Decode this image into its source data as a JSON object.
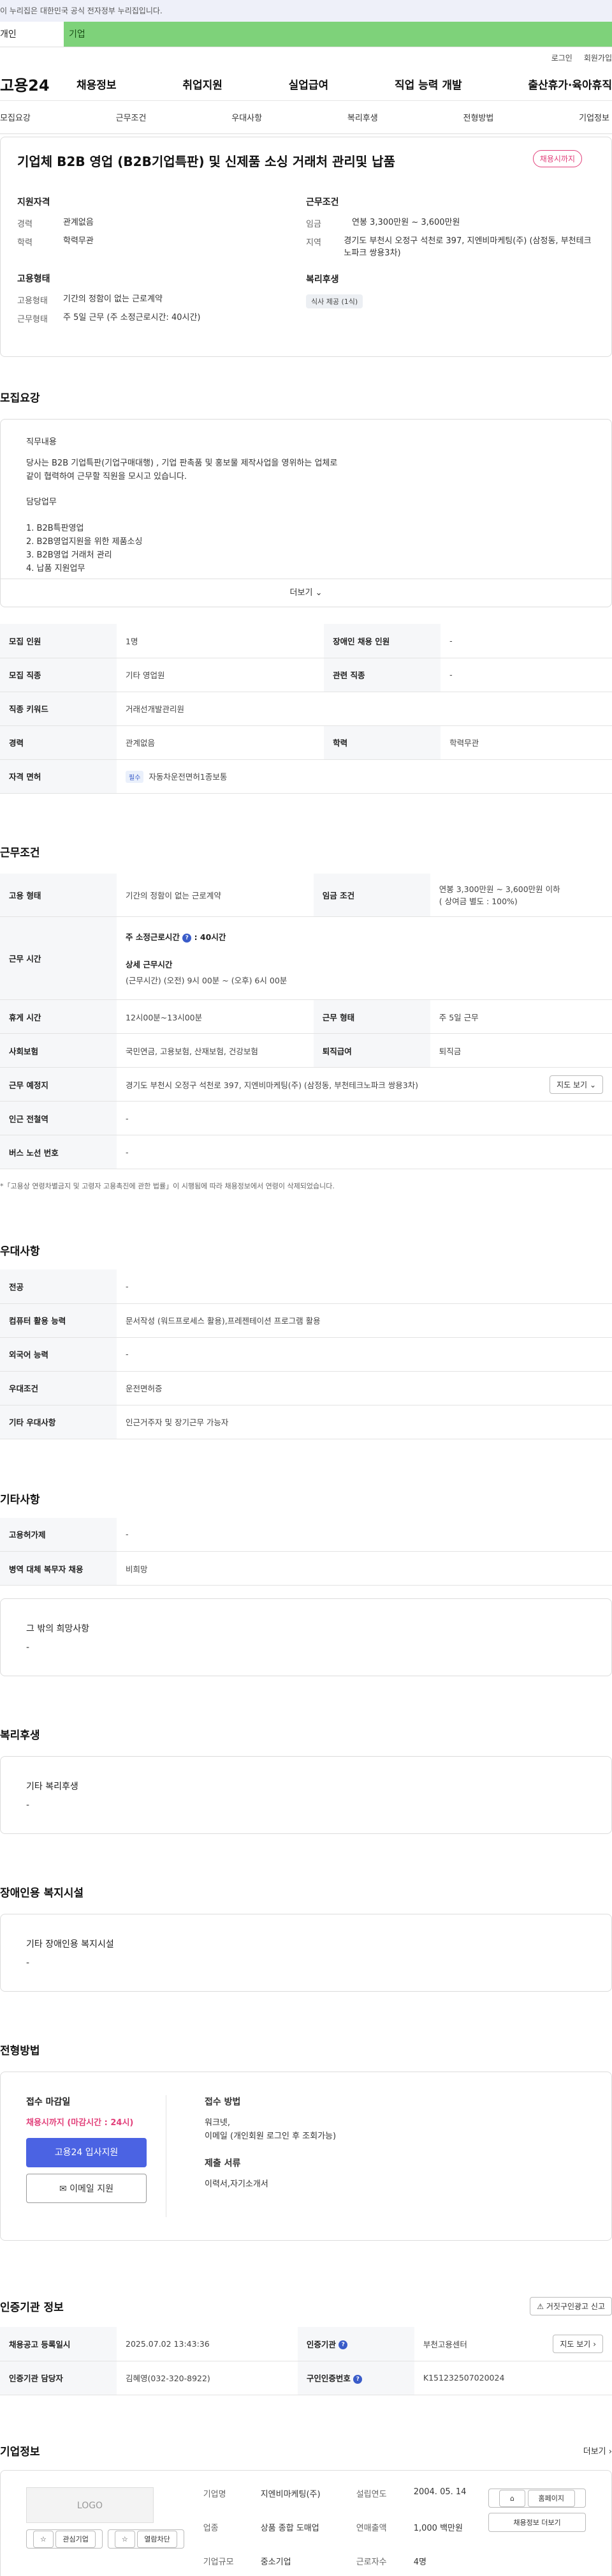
{
  "gov_banner": {
    "text": "이 누리집은 대한민국 공식 전자정부 누리집입니다."
  },
  "role_tabs": {
    "personal": "개인",
    "company": "기업"
  },
  "util": {
    "login": "로그인",
    "signup": "회원가입"
  },
  "gnb": {
    "logo": "고용24",
    "menu": [
      "채용정보",
      "취업지원",
      "실업급여",
      "직업 능력 개발",
      "출산휴가·육아휴직"
    ]
  },
  "anchor_tabs": [
    "모집요강",
    "근무조건",
    "우대사항",
    "복리후생",
    "전형방법",
    "기업정보"
  ],
  "job": {
    "title": "기업체 B2B 영업 (B2B기업특판) 및 신제품 소싱 거래처 관리및 납품",
    "badge": "채용시까지",
    "qual_head": "지원자격",
    "cond_head": "근무조건",
    "emp_head": "고용형태",
    "welfare_head": "복리후생",
    "career_k": "경력",
    "career_v": "관계없음",
    "edu_k": "학력",
    "edu_v": "학력무관",
    "wage_k": "임금",
    "wage_v": "연봉 3,300만원 ~ 3,600만원",
    "region_k": "지역",
    "region_v": "경기도 부천시 오정구 석천로 397, 지엔비마케팅(주) (삼정동, 부천테크노파크 쌍용3차)",
    "emptype_k": "고용형태",
    "emptype_v": "기간의 정함이 없는 근로계약",
    "worktype_k": "근무형태",
    "worktype_v": "주 5일 근무 (주 소정근로시간: 40시간)",
    "welfare_v": "식사 제공 (1식)"
  },
  "recruit": {
    "title": "모집요강",
    "desc_head": "직무내용",
    "desc_line1": "당사는 B2B 기업특판(기업구매대행) , 기업 판촉품 및 홍보물 제작사업을 영위하는 업체로",
    "desc_line2": "같이 협력하여 근무할 직원을 모시고 있습니다.",
    "duty_head": "담당업무",
    "duties": [
      "1. B2B특판영업",
      "2. B2B영업지원을 위한 제품소싱",
      "3. B2B영업 거래처 관리",
      "4. 납품 지원업무"
    ],
    "more": "더보기",
    "rows": {
      "count_k": "모집 인원",
      "count_v": "1명",
      "disabled_k": "장애인 채용 인원",
      "disabled_v": "-",
      "job_k": "모집 직종",
      "job_v": "기타 영업원",
      "related_k": "관련 직종",
      "related_v": "-",
      "keyword_k": "직종 키워드",
      "keyword_v": "거래선개발관리원",
      "career_k": "경력",
      "career_v": "관계없음",
      "edu_k": "학력",
      "edu_v": "학력무관",
      "license_k": "자격 면허",
      "license_tag": "필수",
      "license_v": "자동차운전면허1종보통"
    }
  },
  "conditions": {
    "title": "근무조건",
    "emptype_k": "고용 형태",
    "emptype_v": "기간의 정함이 없는 근로계약",
    "wage_k": "임금 조건",
    "wage_v1": "연봉 3,300만원 ~ 3,600만원 이하",
    "wage_v2": "( 상여금 별도 : 100%)",
    "hours_k": "근무 시간",
    "hours_weekly": "주 소정근로시간",
    "hours_weekly_v": ": 40시간",
    "hours_detail_head": "상세 근무시간",
    "hours_detail_v": "(근무시간) (오전) 9시 00분 ~ (오후) 6시 00분",
    "break_k": "휴게 시간",
    "break_v": "12시00분~13시00분",
    "worktype_k": "근무 형태",
    "worktype_v": "주 5일 근무",
    "insurance_k": "사회보험",
    "insurance_v": "국민연금, 고용보험, 산재보험, 건강보험",
    "severance_k": "퇴직급여",
    "severance_v": "퇴직금",
    "location_k": "근무 예정지",
    "location_v": "경기도 부천시 오정구 석천로 397, 지엔비마케팅(주) (삼정동, 부천테크노파크 쌍용3차)",
    "map_btn": "지도 보기",
    "station_k": "인근 전철역",
    "station_v": "-",
    "bus_k": "버스 노선 번호",
    "bus_v": "-",
    "note": "*「고용상 연령차별금지 및 고령자 고용촉진에 관한 법률」이 시행됨에 따라 채용정보에서 연령이 삭제되었습니다."
  },
  "preferences": {
    "title": "우대사항",
    "major_k": "전공",
    "major_v": "-",
    "computer_k": "컴퓨터 활용 능력",
    "computer_v": "문서작성 (워드프로세스 활용),프레젠테이션 프로그램 활용",
    "lang_k": "외국어 능력",
    "lang_v": "-",
    "pref_k": "우대조건",
    "pref_v": "운전면허증",
    "etc_k": "기타 우대사항",
    "etc_v": "인근거주자 및 장기근무 가능자"
  },
  "other": {
    "title": "기타사항",
    "machine_k": "고용허가제",
    "machine_v": "-",
    "military_k": "병역 대체 복무자 채용",
    "military_v": "비희망",
    "hope_head": "그 밖의 희망사항",
    "hope_v": "-"
  },
  "welfare": {
    "title": "복리후생",
    "head": "기타 복리후생",
    "v": "-"
  },
  "disabled_facility": {
    "title": "장애인용 복지시설",
    "head": "기타 장애인용 복지시설",
    "v": "-"
  },
  "apply": {
    "title": "전형방법",
    "deadline_head": "접수 마감일",
    "deadline_v": "채용시까지 (마감시간 : 24시)",
    "btn_apply": "고용24 입사지원",
    "btn_email": "이메일 지원",
    "method_head": "접수 방법",
    "method_v1": "워크넷,",
    "method_v2": "이메일 (개인회원 로그인 후 조회가능)",
    "docs_head": "제출 서류",
    "docs_v": "이력서,자기소개서"
  },
  "agency": {
    "title": "인증기관 정보",
    "report_btn": "거짓구인광고 신고",
    "reg_k": "채용공고 등록일시",
    "reg_v": "2025.07.02 13:43:36",
    "org_k": "인증기관",
    "org_v": "부천고용센터",
    "map_btn": "지도 보기",
    "mgr_k": "인증기관 담당자",
    "mgr_v": "김혜영(032-320-8922)",
    "no_k": "구인인증번호",
    "no_v": "K151232507020024"
  },
  "company": {
    "title": "기업정보",
    "more": "더보기",
    "logo": "LOGO",
    "fav_btn": "관심기업",
    "block_btn": "열람차단",
    "name_k": "기업명",
    "name_v": "지엔비마케팅(주)",
    "founded_k": "설립연도",
    "founded_v": "2004. 05. 14",
    "industry_k": "업종",
    "industry_v": "상품 종합 도매업",
    "sales_k": "연매출액",
    "sales_v": "1,000 백만원",
    "size_k": "기업규모",
    "size_v": "중소기업",
    "emp_k": "근로자수",
    "emp_v": "4명",
    "homepage_btn": "홈페이지",
    "jobs_btn": "채용정보 더보기"
  }
}
